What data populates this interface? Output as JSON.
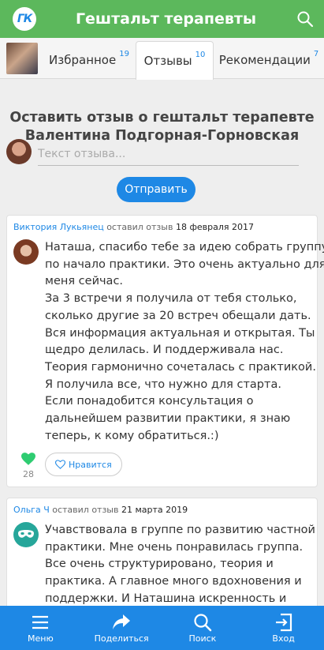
{
  "header": {
    "logo_text": "ГК",
    "title": "Гештальт терапевты"
  },
  "tabs": [
    {
      "label": "Избранное",
      "count": "19"
    },
    {
      "label": "Отзывы",
      "count": "10"
    },
    {
      "label": "Рекомендации",
      "count": "7"
    }
  ],
  "form": {
    "title_line1": "Оставить отзыв о гештальт терапевте",
    "title_line2": "Валентина Подгорная-Горновская",
    "input_placeholder": "Текст отзыва...",
    "submit_label": "Отправить"
  },
  "reviews": [
    {
      "author": "Виктория Лукьянец",
      "action": "оставил отзыв",
      "date": "18 февраля 2017",
      "lines": [
        "Наташа, спасибо тебе за идею собрать группу",
        "по начало практики. Это очень актуально для",
        "меня сейчас.",
        "За 3 встречи я получила от тебя столько,",
        "сколько другие за 20 встреч обещали дать.",
        "Вся информация актуальная и открытая. Ты",
        "щедро делилась. И поддерживала нас.",
        "Теория гармонично сочеталась с практикой.",
        "Я получила все, что нужно для старта.",
        "Если понадобится консультация о",
        "дальнейшем развитии практики, я знаю",
        "теперь, к кому обратиться.:)"
      ],
      "likes": "28",
      "like_label": "Нравится"
    },
    {
      "author": "Ольга Ч",
      "action": "оставил отзыв",
      "date": "21 марта 2019",
      "lines": [
        "Учавствовала в группе по развитию частной",
        "практики. Мне очень понравилась группа.",
        "Все очень структурировано, теория и",
        "практика. А главное много вдохновения и",
        "поддержки. И Наташина искренность и"
      ]
    }
  ],
  "bottom_nav": [
    {
      "label": "Меню",
      "icon": "menu-icon"
    },
    {
      "label": "Поделиться",
      "icon": "share-icon"
    },
    {
      "label": "Поиск",
      "icon": "search-icon"
    },
    {
      "label": "Вход",
      "icon": "login-icon"
    }
  ],
  "colors": {
    "header_green": "#5cb85c",
    "accent_blue": "#1e88e5",
    "heart_green": "#2ecc71"
  }
}
